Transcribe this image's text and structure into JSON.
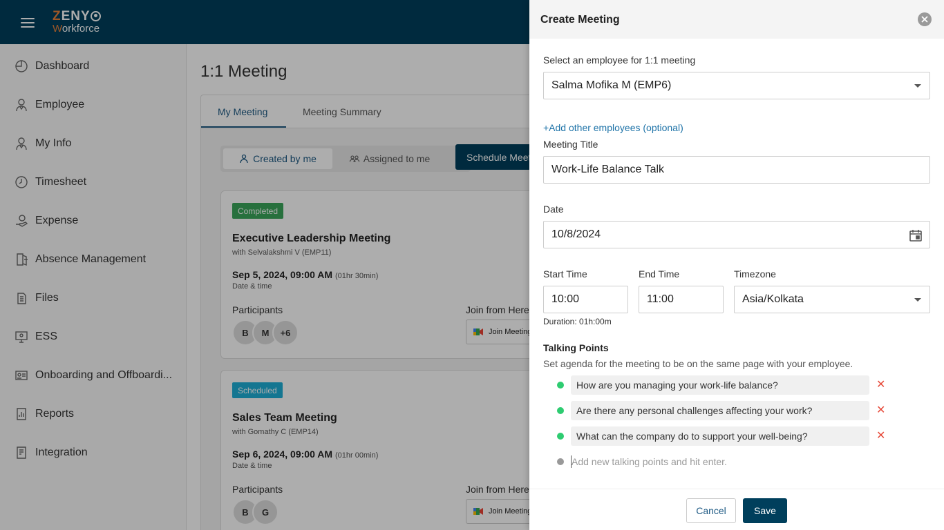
{
  "header": {
    "logo_top": "ZENY",
    "logo_bottom": "Workforce"
  },
  "sidebar": {
    "items": [
      {
        "label": "Dashboard",
        "icon": "dashboard-icon"
      },
      {
        "label": "Employee",
        "icon": "employee-icon"
      },
      {
        "label": "My Info",
        "icon": "my-info-icon"
      },
      {
        "label": "Timesheet",
        "icon": "clock-icon"
      },
      {
        "label": "Expense",
        "icon": "expense-icon"
      },
      {
        "label": "Absence Management",
        "icon": "exit-door-icon"
      },
      {
        "label": "Files",
        "icon": "files-icon"
      },
      {
        "label": "ESS",
        "icon": "ess-icon"
      },
      {
        "label": "Onboarding and Offboardi...",
        "icon": "id-card-icon"
      },
      {
        "label": "Reports",
        "icon": "reports-icon"
      },
      {
        "label": "Integration",
        "icon": "integration-icon"
      }
    ]
  },
  "main": {
    "page_title": "1:1 Meeting",
    "tabs": [
      {
        "label": "My Meeting"
      },
      {
        "label": "Meeting Summary"
      }
    ],
    "toggle": {
      "created": "Created by me",
      "assigned": "Assigned to me"
    },
    "schedule_btn": "Schedule Meeting",
    "cards": [
      {
        "status": "Completed",
        "title": "Executive Leadership Meeting",
        "with": "with Selvalakshmi V (EMP11)",
        "date": "Sep 5, 2024, 09:00 AM",
        "duration": "(01hr 30min)",
        "date_label": "Date & time",
        "participants_label": "Participants",
        "join_label": "Join from Here",
        "join_btn": "Join Meeting",
        "avatars": [
          "B",
          "M",
          "+6"
        ]
      },
      {
        "status": "Scheduled",
        "title": "Sales Team Meeting",
        "with": "with Gomathy C (EMP14)",
        "date": "Sep 6, 2024, 09:00 AM",
        "duration": "(01hr 00min)",
        "date_label": "Date & time",
        "participants_label": "Participants",
        "join_label": "Join from Here",
        "join_btn": "Join Meeting",
        "avatars": [
          "B",
          "G"
        ]
      }
    ]
  },
  "drawer": {
    "title": "Create Meeting",
    "employee_label": "Select an employee for 1:1 meeting",
    "employee_value": "Salma Mofika M (EMP6)",
    "add_others": "+Add other employees (optional)",
    "title_label": "Meeting Title",
    "title_value": "Work-Life Balance Talk",
    "date_label": "Date",
    "date_value": "10/8/2024",
    "start_label": "Start Time",
    "start_value": "10:00",
    "end_label": "End Time",
    "end_value": "11:00",
    "tz_label": "Timezone",
    "tz_value": "Asia/Kolkata",
    "duration": "Duration: 01h:00m",
    "tp_title": "Talking Points",
    "tp_sub": "Set agenda for the meeting to be on the same page with your employee.",
    "talking_points": [
      "How are you managing your work-life balance?",
      "Are there any personal challenges affecting your work?",
      "What can the company do to support your well-being?"
    ],
    "tp_placeholder": "Add new talking points and hit enter.",
    "cancel": "Cancel",
    "save": "Save"
  },
  "colors": {
    "primary": "#003f5c",
    "link": "#1e73a8",
    "completed": "#3aa55a",
    "scheduled": "#1eaed6",
    "dot": "#2ecc71",
    "remove": "#e74c3c"
  }
}
